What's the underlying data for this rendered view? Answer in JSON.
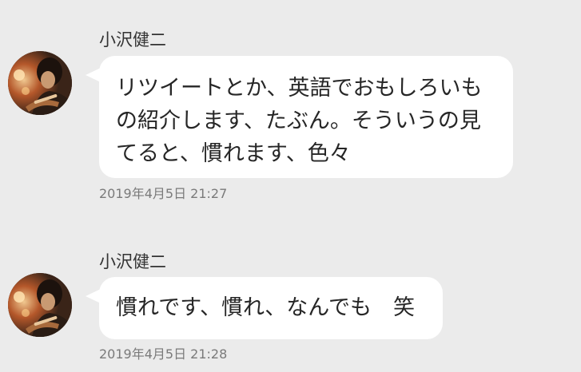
{
  "messages": [
    {
      "sender": "小沢健二",
      "avatar": "avatar-photo",
      "lines": [
        "リツイートとか、英語でおもしろいも",
        "の紹介します、たぶん。そういうの見",
        "てると、慣れます、色々"
      ],
      "timestamp": "2019年4月5日 21:27"
    },
    {
      "sender": "小沢健二",
      "avatar": "avatar-photo",
      "lines": [
        "慣れです、慣れ、なんでも　笑"
      ],
      "timestamp": "2019年4月5日 21:28"
    }
  ],
  "colors": {
    "background": "#ebebeb",
    "bubble": "#ffffff",
    "text": "#262626",
    "timestamp": "#7a7a7a"
  }
}
